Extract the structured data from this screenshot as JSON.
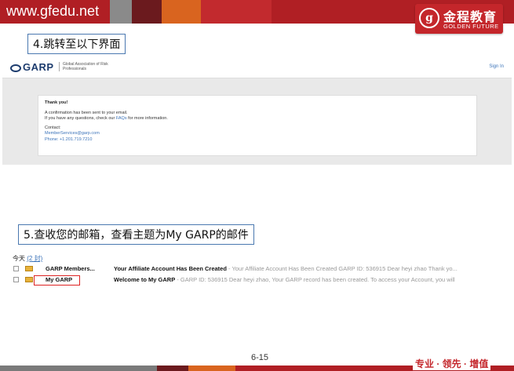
{
  "header": {
    "site": "www.gfedu.net"
  },
  "brand": {
    "mark": "g",
    "name_cn": "金程教育",
    "name_en": "GOLDEN FUTURE"
  },
  "step4": {
    "label": "4.跳转至以下界面"
  },
  "garp_page": {
    "logo_text": "GARP",
    "logo_sub": "Global Association of Risk Professionals",
    "signin": "Sign In",
    "card": {
      "title": "Thank you!",
      "line1": "A confirmation has been sent to your email.",
      "line2_pre": "If you have any questions, check our ",
      "line2_link": "FAQs",
      "line2_post": " for more information.",
      "contact": "Contact:",
      "email": "MemberServices@garp.com",
      "phone": "Phone: +1.201.719.7210"
    }
  },
  "step5": {
    "label": "5.查收您的邮箱，查看主题为My GARP的邮件"
  },
  "inbox": {
    "group_label": "今天",
    "group_count": "(2 封)",
    "rows": [
      {
        "from": "GARP Members...",
        "subject": "Your Affiliate Account Has Been Created",
        "preview": " - Your Affiliate Account Has Been Created GARP ID: 536915 Dear heyi zhao Thank yo..."
      },
      {
        "from": "My GARP",
        "subject": "Welcome to My GARP",
        "preview": " - GARP ID: 536915 Dear heyi zhao, Your GARP record has been created. To access your Account, you will"
      }
    ]
  },
  "footer": {
    "page": "6-15",
    "slogan": "专业 · 领先 · 增值"
  },
  "colors": {
    "brand_red": "#b01f24",
    "link_blue": "#3b73b9",
    "step_border": "#4a78b0"
  }
}
